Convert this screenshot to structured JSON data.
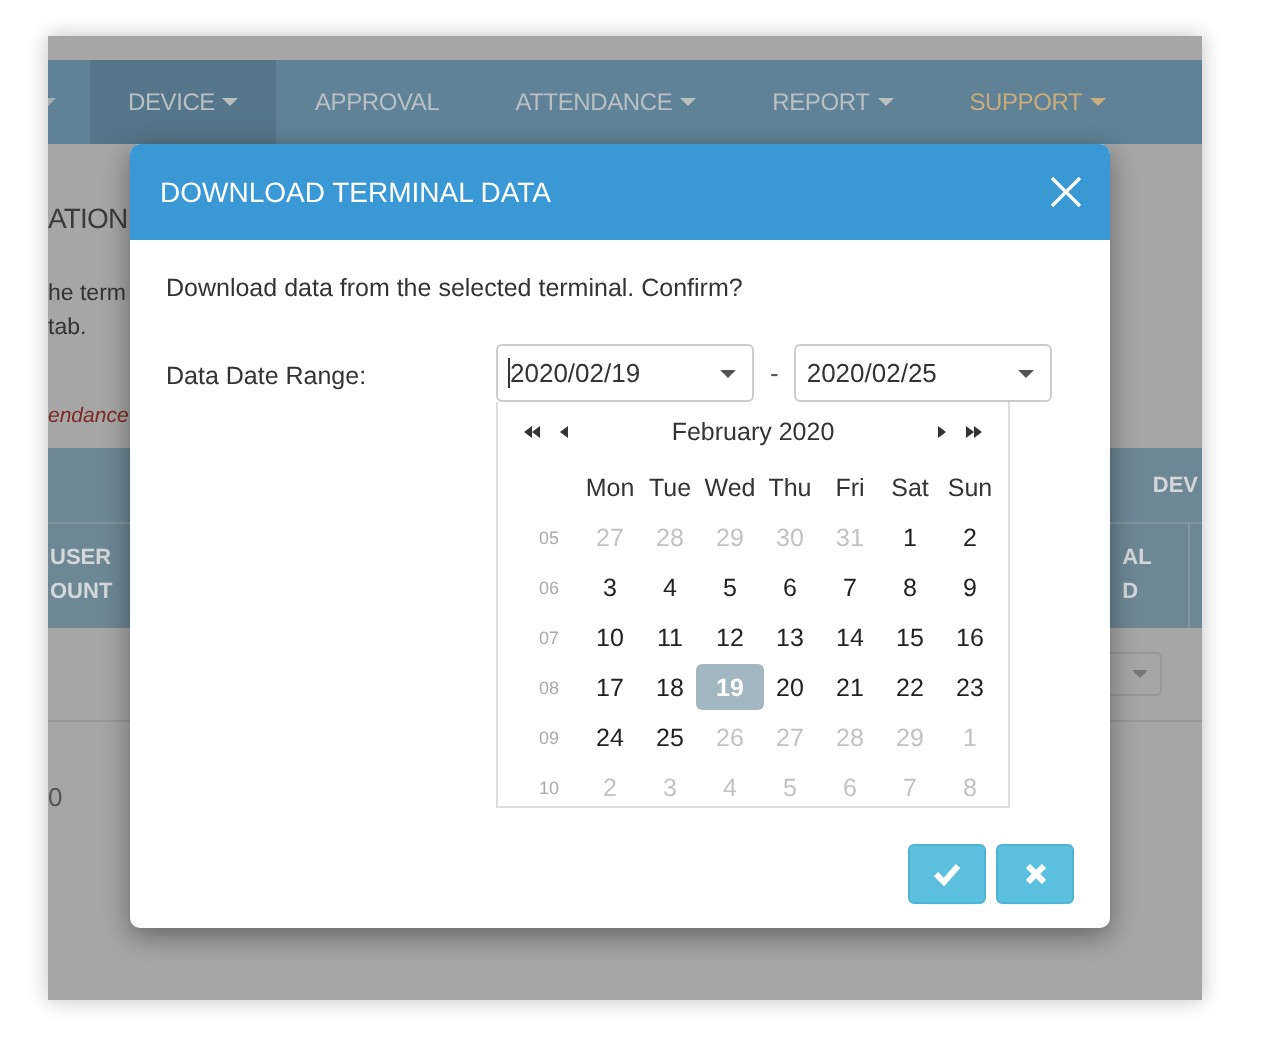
{
  "background_page": {
    "nav": [
      {
        "label": "DEVICE",
        "dropdown": true,
        "selected": true,
        "kind": "normal"
      },
      {
        "label": "APPROVAL",
        "dropdown": false,
        "selected": false,
        "kind": "normal"
      },
      {
        "label": "ATTENDANCE",
        "dropdown": true,
        "selected": false,
        "kind": "normal"
      },
      {
        "label": "REPORT",
        "dropdown": true,
        "selected": false,
        "kind": "normal"
      },
      {
        "label": "SUPPORT",
        "dropdown": true,
        "selected": false,
        "kind": "accent"
      }
    ],
    "heading": "ATION",
    "description_lines": [
      "he term",
      "tab."
    ],
    "notice": "endance",
    "table": {
      "group_header": "DEV",
      "columns": [
        [
          "USER",
          "OUNT"
        ],
        [
          "AL",
          "D"
        ]
      ],
      "cell": "0"
    }
  },
  "dialog": {
    "title": "DOWNLOAD TERMINAL DATA",
    "message": "Download data from the selected terminal. Confirm?",
    "range_label": "Data Date Range:",
    "start_date": {
      "value": "2020/02/19",
      "focused": true
    },
    "separator": "-",
    "end_date": {
      "value": "2020/02/25",
      "focused": false
    },
    "calendar": {
      "month": "February 2020",
      "weekdays": [
        "Mon",
        "Tue",
        "Wed",
        "Thu",
        "Fri",
        "Sat",
        "Sun"
      ],
      "weeks": [
        {
          "week": "05",
          "days": [
            {
              "label": "27",
              "disabled": true,
              "selected": false
            },
            {
              "label": "28",
              "disabled": true,
              "selected": false
            },
            {
              "label": "29",
              "disabled": true,
              "selected": false
            },
            {
              "label": "30",
              "disabled": true,
              "selected": false
            },
            {
              "label": "31",
              "disabled": true,
              "selected": false
            },
            {
              "label": "1",
              "disabled": false,
              "selected": false
            },
            {
              "label": "2",
              "disabled": false,
              "selected": false
            }
          ]
        },
        {
          "week": "06",
          "days": [
            {
              "label": "3",
              "disabled": false,
              "selected": false
            },
            {
              "label": "4",
              "disabled": false,
              "selected": false
            },
            {
              "label": "5",
              "disabled": false,
              "selected": false
            },
            {
              "label": "6",
              "disabled": false,
              "selected": false
            },
            {
              "label": "7",
              "disabled": false,
              "selected": false
            },
            {
              "label": "8",
              "disabled": false,
              "selected": false
            },
            {
              "label": "9",
              "disabled": false,
              "selected": false
            }
          ]
        },
        {
          "week": "07",
          "days": [
            {
              "label": "10",
              "disabled": false,
              "selected": false
            },
            {
              "label": "11",
              "disabled": false,
              "selected": false
            },
            {
              "label": "12",
              "disabled": false,
              "selected": false
            },
            {
              "label": "13",
              "disabled": false,
              "selected": false
            },
            {
              "label": "14",
              "disabled": false,
              "selected": false
            },
            {
              "label": "15",
              "disabled": false,
              "selected": false
            },
            {
              "label": "16",
              "disabled": false,
              "selected": false
            }
          ]
        },
        {
          "week": "08",
          "days": [
            {
              "label": "17",
              "disabled": false,
              "selected": false
            },
            {
              "label": "18",
              "disabled": false,
              "selected": false
            },
            {
              "label": "19",
              "disabled": false,
              "selected": true
            },
            {
              "label": "20",
              "disabled": false,
              "selected": false
            },
            {
              "label": "21",
              "disabled": false,
              "selected": false
            },
            {
              "label": "22",
              "disabled": false,
              "selected": false
            },
            {
              "label": "23",
              "disabled": false,
              "selected": false
            }
          ]
        },
        {
          "week": "09",
          "days": [
            {
              "label": "24",
              "disabled": false,
              "selected": false
            },
            {
              "label": "25",
              "disabled": false,
              "selected": false
            },
            {
              "label": "26",
              "disabled": true,
              "selected": false
            },
            {
              "label": "27",
              "disabled": true,
              "selected": false
            },
            {
              "label": "28",
              "disabled": true,
              "selected": false
            },
            {
              "label": "29",
              "disabled": true,
              "selected": false
            },
            {
              "label": "1",
              "disabled": true,
              "selected": false
            }
          ]
        },
        {
          "week": "10",
          "days": [
            {
              "label": "2",
              "disabled": true,
              "selected": false
            },
            {
              "label": "3",
              "disabled": true,
              "selected": false
            },
            {
              "label": "4",
              "disabled": true,
              "selected": false
            },
            {
              "label": "5",
              "disabled": true,
              "selected": false
            },
            {
              "label": "6",
              "disabled": true,
              "selected": false
            },
            {
              "label": "7",
              "disabled": true,
              "selected": false
            },
            {
              "label": "8",
              "disabled": true,
              "selected": false
            }
          ]
        }
      ]
    },
    "buttons": [
      {
        "kind": "confirm"
      },
      {
        "kind": "cancel"
      }
    ]
  }
}
